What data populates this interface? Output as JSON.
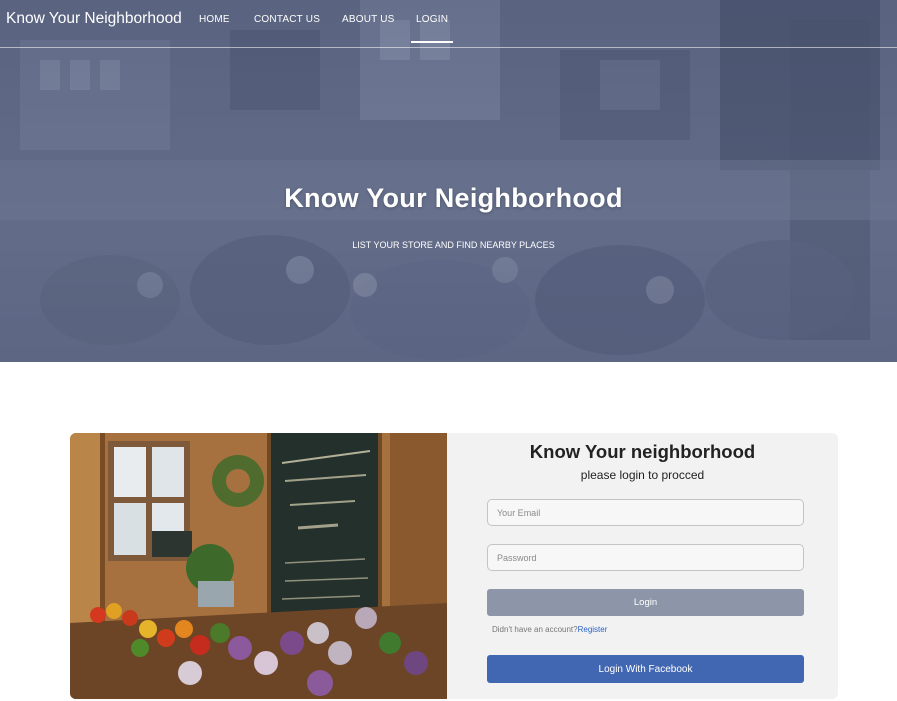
{
  "navbar": {
    "brand": "Know Your Neighborhood",
    "items": [
      {
        "label": "HOME",
        "active": false
      },
      {
        "label": "CONTACT US",
        "active": false
      },
      {
        "label": "ABOUT US",
        "active": false
      },
      {
        "label": "LOGIN",
        "active": true
      }
    ]
  },
  "hero": {
    "title": "Know Your Neighborhood",
    "subtitle": "LIST YOUR STORE AND FIND NEARBY PLACES"
  },
  "login": {
    "title": "Know Your neighborhood",
    "subtitle": "please login to procced",
    "email_placeholder": "Your Email",
    "password_placeholder": "Password",
    "login_button": "Login",
    "register_prompt": "Didn't have an account?",
    "register_link": "Register",
    "facebook_button": "Login With Facebook"
  },
  "colors": {
    "login_button": "#8d96a8",
    "facebook_button": "#4267b2",
    "register_link": "#2a64c8",
    "card_background": "#f2f2f2"
  }
}
